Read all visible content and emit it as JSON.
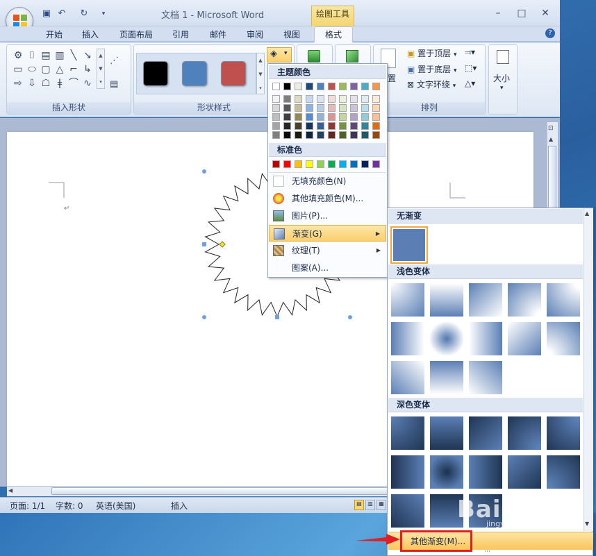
{
  "window": {
    "title": "文档 1 - Microsoft Word",
    "context_tab": "绘图工具",
    "minimize": "–",
    "maximize": "□",
    "close": "✕"
  },
  "tabs": [
    "开始",
    "插入",
    "页面布局",
    "引用",
    "邮件",
    "审阅",
    "视图"
  ],
  "active_tab": "格式",
  "ribbon": {
    "groups": {
      "insert_shapes": "插入形状",
      "shape_styles": "形状样式",
      "arrange": "排列"
    },
    "arrange": {
      "bring_to_front": "置于顶层",
      "send_to_back": "置于底层",
      "text_wrap": "文字环绕",
      "position": "置"
    },
    "size": "大小",
    "style_swatches": [
      "#000000",
      "#4f81bd",
      "#c0504d"
    ]
  },
  "fill_menu": {
    "theme_colors_header": "主题颜色",
    "standard_colors_header": "标准色",
    "theme_top_row": [
      "#ffffff",
      "#000000",
      "#eeece1",
      "#1f497d",
      "#4f81bd",
      "#c0504d",
      "#9bbb59",
      "#8064a2",
      "#4bacc6",
      "#f79646"
    ],
    "theme_shades": [
      [
        "#f2f2f2",
        "#7f7f7f",
        "#ddd9c3",
        "#c6d9f0",
        "#dbe5f1",
        "#f2dcdb",
        "#ebf1dd",
        "#e5e0ec",
        "#dbeef3",
        "#fdeada"
      ],
      [
        "#d8d8d8",
        "#595959",
        "#c4bd97",
        "#8db3e2",
        "#b8cce4",
        "#e5b9b7",
        "#d7e3bc",
        "#ccc1d9",
        "#b7dde8",
        "#fbd5b5"
      ],
      [
        "#bfbfbf",
        "#3f3f3f",
        "#938953",
        "#548dd4",
        "#95b3d7",
        "#d99694",
        "#c3d69b",
        "#b2a2c7",
        "#92cddc",
        "#fac08f"
      ],
      [
        "#a5a5a5",
        "#262626",
        "#494429",
        "#17365d",
        "#366092",
        "#953734",
        "#76923c",
        "#5f497a",
        "#31859b",
        "#e36c09"
      ],
      [
        "#7f7f7f",
        "#0c0c0c",
        "#1d1b10",
        "#0f243e",
        "#244061",
        "#632423",
        "#4f6128",
        "#3f3151",
        "#205867",
        "#974806"
      ]
    ],
    "standard_colors": [
      "#c00000",
      "#ff0000",
      "#ffc000",
      "#ffff00",
      "#92d050",
      "#00b050",
      "#00b0f0",
      "#0070c0",
      "#002060",
      "#7030a0"
    ],
    "no_fill": "无填充颜色(N)",
    "more_colors": "其他填充颜色(M)...",
    "picture": "图片(P)...",
    "gradient": "渐变(G)",
    "texture": "纹理(T)",
    "pattern": "图案(A)..."
  },
  "gradient_gallery": {
    "no_gradient_header": "无渐变",
    "light_header": "浅色变体",
    "dark_header": "深色变体",
    "more_gradients": "其他渐变(M)...",
    "base_color": "#5b7fb5"
  },
  "status": {
    "page": "页面: 1/1",
    "words": "字数: 0",
    "language": "英语(美国)",
    "mode": "插入"
  },
  "watermark": {
    "brand": "Bai 经验",
    "url": "jingyan.baidu.com"
  }
}
